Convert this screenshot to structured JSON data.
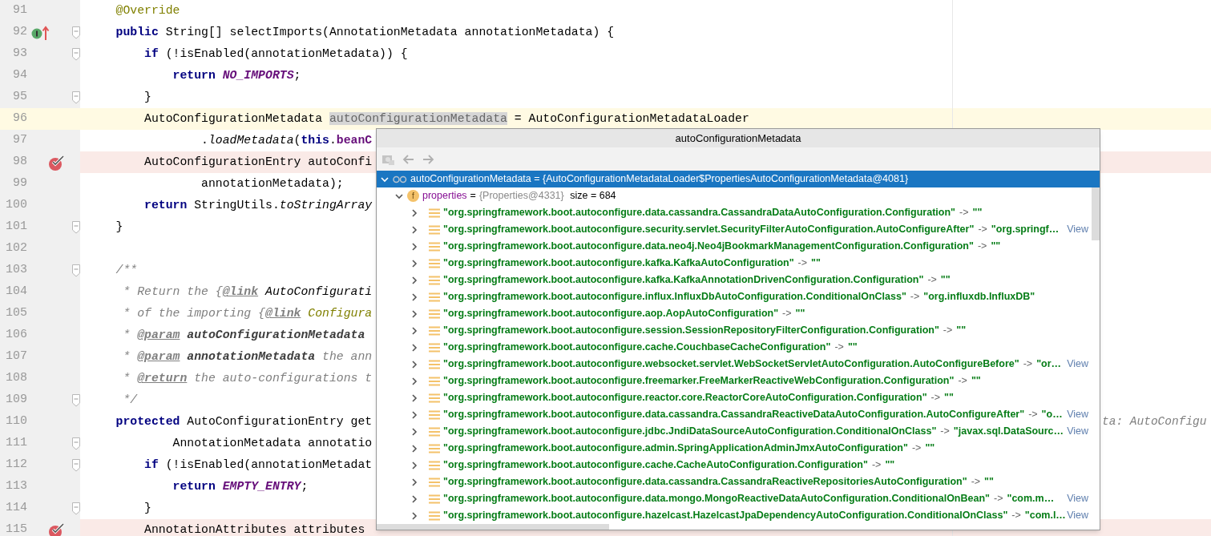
{
  "editor": {
    "lines": [
      {
        "number": "91",
        "fold": false,
        "caret_line": false,
        "breakpoint": false,
        "implements": false,
        "tokens": [
          {
            "kind": "annotation",
            "text": "    @Override"
          }
        ]
      },
      {
        "number": "92",
        "fold": true,
        "caret_line": false,
        "breakpoint": false,
        "implements": true,
        "tokens": [
          {
            "kind": "keyword",
            "text": "    public"
          },
          {
            "kind": "plain",
            "text": " String[] selectImports(AnnotationMetadata annotationMetadata) {"
          }
        ]
      },
      {
        "number": "93",
        "fold": true,
        "caret_line": false,
        "breakpoint": false,
        "implements": false,
        "tokens": [
          {
            "kind": "keyword",
            "text": "        if"
          },
          {
            "kind": "plain",
            "text": " (!isEnabled(annotationMetadata)) {"
          }
        ]
      },
      {
        "number": "94",
        "fold": false,
        "caret_line": false,
        "breakpoint": false,
        "implements": false,
        "tokens": [
          {
            "kind": "keyword",
            "text": "            return"
          },
          {
            "kind": "constant",
            "text": " NO_IMPORTS"
          },
          {
            "kind": "plain",
            "text": ";"
          }
        ]
      },
      {
        "number": "95",
        "fold": true,
        "caret_line": false,
        "breakpoint": false,
        "implements": false,
        "tokens": [
          {
            "kind": "plain",
            "text": "        }"
          }
        ]
      },
      {
        "number": "96",
        "fold": false,
        "caret_line": true,
        "breakpoint": false,
        "implements": false,
        "tokens": [
          {
            "kind": "plain",
            "text": "        AutoConfigurationMetadata "
          },
          {
            "kind": "selected",
            "text": "autoConfigurationMetadata"
          },
          {
            "kind": "plain",
            "text": " = AutoConfigurationMetadataLoader"
          }
        ]
      },
      {
        "number": "97",
        "fold": false,
        "caret_line": false,
        "breakpoint": false,
        "implements": false,
        "tokens": [
          {
            "kind": "plain",
            "text": "                ."
          },
          {
            "kind": "static",
            "text": "loadMetadata"
          },
          {
            "kind": "plain",
            "text": "("
          },
          {
            "kind": "keyword",
            "text": "this"
          },
          {
            "kind": "plain",
            "text": "."
          },
          {
            "kind": "field",
            "text": "beanC"
          }
        ]
      },
      {
        "number": "98",
        "fold": false,
        "caret_line": false,
        "breakpoint": true,
        "implements": false,
        "tokens": [
          {
            "kind": "plain",
            "text": "        AutoConfigurationEntry autoConfi"
          }
        ]
      },
      {
        "number": "99",
        "fold": false,
        "caret_line": false,
        "breakpoint": false,
        "implements": false,
        "tokens": [
          {
            "kind": "plain",
            "text": "                annotationMetadata);"
          }
        ]
      },
      {
        "number": "100",
        "fold": false,
        "caret_line": false,
        "breakpoint": false,
        "implements": false,
        "tokens": [
          {
            "kind": "keyword",
            "text": "        return"
          },
          {
            "kind": "plain",
            "text": " StringUtils."
          },
          {
            "kind": "static",
            "text": "toStringArray"
          }
        ]
      },
      {
        "number": "101",
        "fold": true,
        "caret_line": false,
        "breakpoint": false,
        "implements": false,
        "tokens": [
          {
            "kind": "plain",
            "text": "    }"
          }
        ]
      },
      {
        "number": "102",
        "fold": false,
        "caret_line": false,
        "breakpoint": false,
        "implements": false
      },
      {
        "number": "103",
        "fold": true,
        "caret_line": false,
        "breakpoint": false,
        "implements": false,
        "tokens": [
          {
            "kind": "comment",
            "text": "    /**"
          }
        ]
      },
      {
        "number": "104",
        "fold": false,
        "caret_line": false,
        "breakpoint": false,
        "implements": false,
        "tokens": [
          {
            "kind": "comment",
            "text": "     * Return the {"
          },
          {
            "kind": "doc-tag",
            "text": "@link"
          },
          {
            "kind": "doc-ref",
            "text": " AutoConfigurati"
          }
        ]
      },
      {
        "number": "105",
        "fold": false,
        "caret_line": false,
        "breakpoint": false,
        "implements": false,
        "tokens": [
          {
            "kind": "comment",
            "text": "     * of the importing {"
          },
          {
            "kind": "doc-tag",
            "text": "@link"
          },
          {
            "kind": "doc-ref-annotation",
            "text": " Configura"
          }
        ]
      },
      {
        "number": "106",
        "fold": false,
        "caret_line": false,
        "breakpoint": false,
        "implements": false,
        "tokens": [
          {
            "kind": "comment",
            "text": "     * "
          },
          {
            "kind": "doc-tag",
            "text": "@param"
          },
          {
            "kind": "doc-param",
            "text": " autoConfigurationMetadata"
          }
        ]
      },
      {
        "number": "107",
        "fold": false,
        "caret_line": false,
        "breakpoint": false,
        "implements": false,
        "tokens": [
          {
            "kind": "comment",
            "text": "     * "
          },
          {
            "kind": "doc-tag",
            "text": "@param"
          },
          {
            "kind": "doc-param",
            "text": " annotationMetadata"
          },
          {
            "kind": "comment",
            "text": " the ann"
          }
        ]
      },
      {
        "number": "108",
        "fold": false,
        "caret_line": false,
        "breakpoint": false,
        "implements": false,
        "tokens": [
          {
            "kind": "comment",
            "text": "     * "
          },
          {
            "kind": "doc-tag",
            "text": "@return"
          },
          {
            "kind": "comment",
            "text": " the auto-configurations t"
          }
        ]
      },
      {
        "number": "109",
        "fold": true,
        "caret_line": false,
        "breakpoint": false,
        "implements": false,
        "tokens": [
          {
            "kind": "comment",
            "text": "     */"
          }
        ]
      },
      {
        "number": "110",
        "fold": false,
        "caret_line": false,
        "breakpoint": false,
        "implements": false,
        "tokens": [
          {
            "kind": "keyword",
            "text": "    protected"
          },
          {
            "kind": "plain",
            "text": " AutoConfigurationEntry get"
          }
        ],
        "inline_value": "ta: AutoConfigu"
      },
      {
        "number": "111",
        "fold": true,
        "caret_line": false,
        "breakpoint": false,
        "implements": false,
        "tokens": [
          {
            "kind": "plain",
            "text": "            AnnotationMetadata annotatio"
          }
        ]
      },
      {
        "number": "112",
        "fold": true,
        "caret_line": false,
        "breakpoint": false,
        "implements": false,
        "tokens": [
          {
            "kind": "keyword",
            "text": "        if"
          },
          {
            "kind": "plain",
            "text": " (!isEnabled(annotationMetadat"
          }
        ]
      },
      {
        "number": "113",
        "fold": false,
        "caret_line": false,
        "breakpoint": false,
        "implements": false,
        "tokens": [
          {
            "kind": "keyword",
            "text": "            return"
          },
          {
            "kind": "constant",
            "text": " EMPTY_ENTRY"
          },
          {
            "kind": "plain",
            "text": ";"
          }
        ]
      },
      {
        "number": "114",
        "fold": true,
        "caret_line": false,
        "breakpoint": false,
        "implements": false,
        "tokens": [
          {
            "kind": "plain",
            "text": "        }"
          }
        ]
      },
      {
        "number": "115",
        "fold": false,
        "caret_line": false,
        "breakpoint": true,
        "implements": false,
        "tokens": [
          {
            "kind": "plain",
            "text": "        AnnotationAttributes attributes"
          }
        ]
      }
    ]
  },
  "popup": {
    "title": "autoConfigurationMetadata",
    "root": {
      "expanded": true,
      "selected": true,
      "name": "autoConfigurationMetadata",
      "value": "= {AutoConfigurationMetadataLoader$PropertiesAutoConfigurationMetadata@4081}"
    },
    "properties": {
      "expanded": true,
      "badge": "f",
      "name": "properties",
      "equals": "=",
      "value": "{Properties@4331}",
      "size": "size = 684"
    },
    "entries": [
      {
        "key": "\"org.springframework.boot.autoconfigure.data.cassandra.CassandraDataAutoConfiguration.Configuration\"",
        "arrow": "->",
        "value": "\"\""
      },
      {
        "key": "\"org.springframework.boot.autoconfigure.security.servlet.SecurityFilterAutoConfiguration.AutoConfigureAfter\"",
        "arrow": "->",
        "value": "\"org.springf…",
        "view": "View"
      },
      {
        "key": "\"org.springframework.boot.autoconfigure.data.neo4j.Neo4jBookmarkManagementConfiguration.Configuration\"",
        "arrow": "->",
        "value": "\"\""
      },
      {
        "key": "\"org.springframework.boot.autoconfigure.kafka.KafkaAutoConfiguration\"",
        "arrow": "->",
        "value": "\"\""
      },
      {
        "key": "\"org.springframework.boot.autoconfigure.kafka.KafkaAnnotationDrivenConfiguration.Configuration\"",
        "arrow": "->",
        "value": "\"\""
      },
      {
        "key": "\"org.springframework.boot.autoconfigure.influx.InfluxDbAutoConfiguration.ConditionalOnClass\"",
        "arrow": "->",
        "value": "\"org.influxdb.InfluxDB\""
      },
      {
        "key": "\"org.springframework.boot.autoconfigure.aop.AopAutoConfiguration\"",
        "arrow": "->",
        "value": "\"\""
      },
      {
        "key": "\"org.springframework.boot.autoconfigure.session.SessionRepositoryFilterConfiguration.Configuration\"",
        "arrow": "->",
        "value": "\"\""
      },
      {
        "key": "\"org.springframework.boot.autoconfigure.cache.CouchbaseCacheConfiguration\"",
        "arrow": "->",
        "value": "\"\""
      },
      {
        "key": "\"org.springframework.boot.autoconfigure.websocket.servlet.WebSocketServletAutoConfiguration.AutoConfigureBefore\"",
        "arrow": "->",
        "value": "\"or…",
        "view": "View"
      },
      {
        "key": "\"org.springframework.boot.autoconfigure.freemarker.FreeMarkerReactiveWebConfiguration.Configuration\"",
        "arrow": "->",
        "value": "\"\""
      },
      {
        "key": "\"org.springframework.boot.autoconfigure.reactor.core.ReactorCoreAutoConfiguration.Configuration\"",
        "arrow": "->",
        "value": "\"\""
      },
      {
        "key": "\"org.springframework.boot.autoconfigure.data.cassandra.CassandraReactiveDataAutoConfiguration.AutoConfigureAfter\"",
        "arrow": "->",
        "value": "\"o…",
        "view": "View"
      },
      {
        "key": "\"org.springframework.boot.autoconfigure.jdbc.JndiDataSourceAutoConfiguration.ConditionalOnClass\"",
        "arrow": "->",
        "value": "\"javax.sql.DataSourc…",
        "view": "View"
      },
      {
        "key": "\"org.springframework.boot.autoconfigure.admin.SpringApplicationAdminJmxAutoConfiguration\"",
        "arrow": "->",
        "value": "\"\""
      },
      {
        "key": "\"org.springframework.boot.autoconfigure.cache.CacheAutoConfiguration.Configuration\"",
        "arrow": "->",
        "value": "\"\""
      },
      {
        "key": "\"org.springframework.boot.autoconfigure.data.cassandra.CassandraReactiveRepositoriesAutoConfiguration\"",
        "arrow": "->",
        "value": "\"\""
      },
      {
        "key": "\"org.springframework.boot.autoconfigure.data.mongo.MongoReactiveDataAutoConfiguration.ConditionalOnBean\"",
        "arrow": "->",
        "value": "\"com.m…",
        "view": "View"
      },
      {
        "key": "\"org.springframework.boot.autoconfigure.hazelcast.HazelcastJpaDependencyAutoConfiguration.ConditionalOnClass\"",
        "arrow": "->",
        "value": "\"com.l…",
        "view": "View"
      }
    ]
  }
}
